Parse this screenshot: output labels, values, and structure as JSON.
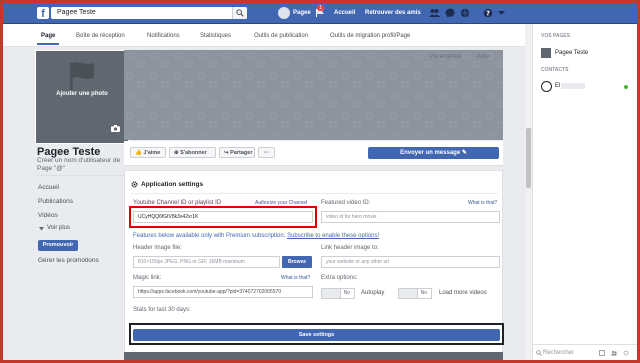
{
  "topbar": {
    "logo": "f",
    "search_value": "Pagee Teste",
    "profile_name": "Pagee",
    "home_label": "Accueil",
    "find_friends_label": "Retrouver des amis",
    "notification_count": "1"
  },
  "tabs": [
    {
      "label": "Page"
    },
    {
      "label": "Boîte de réception"
    },
    {
      "label": "Notifications"
    },
    {
      "label": "Statistiques"
    },
    {
      "label": "Outils de publication"
    },
    {
      "label": "Outils de migration profil/Page"
    }
  ],
  "left": {
    "add_photo_label": "Ajouter une photo",
    "page_name": "Pagee Teste",
    "username_prompt": "Créer un nom d'utilisateur de Page \"@\"",
    "nav": [
      "Accueil",
      "Publications",
      "Vidéos"
    ],
    "see_more": "Voir plus",
    "promote_label": "Promouvoir",
    "manage_promotions": "Gérer les promotions"
  },
  "cover": {
    "tabs": [
      "Paramètres",
      "Aide"
    ]
  },
  "actions": {
    "like": "J'aime",
    "follow": "S'abonner",
    "share": "Partager",
    "more": "···",
    "send_message": "Envoyer un message"
  },
  "settings": {
    "title": "Application settings",
    "channel_label": "Youtube Channel ID or playlist ID",
    "authorize_link": "Authorize your Channel",
    "channel_value": "UCyHQQ6fGtV8k3s42xr1K",
    "featured_label": "Featured video ID:",
    "featured_help": "What is that?",
    "featured_placeholder": "video id for hero movie",
    "premium_notice": "Features below available only with Premium subscription.",
    "subscribe_link": "Subscribe to enable these options!",
    "header_image_label": "Header image file:",
    "header_image_placeholder": "810×150px JPEG, PNG or GIF, 16MB maximum",
    "browse_label": "Browse",
    "link_header_label": "Link header image to:",
    "link_header_placeholder": "your website or any other url",
    "magic_link_label": "Magic link:",
    "magic_help": "What is that?",
    "magic_link_value": "https://apps.facebook.com/youtube-app/?pid=374072702065570",
    "extra_options_label": "Extra options:",
    "autoplay_toggle": "No",
    "autoplay_label": "Autoplay",
    "load_more_toggle": "No",
    "load_more_label": "Load more videos",
    "stats_label": "Stats for last 30 days:",
    "save_label": "Save settings"
  },
  "right": {
    "pages_heading": "VOS PAGES",
    "page_entry": "Pagee Teste",
    "contacts_heading": "CONTACTS",
    "contact_initial": "El",
    "chat_search_placeholder": "Rechercher"
  },
  "colors": {
    "brand": "#4267b2",
    "highlight_red": "#e00000",
    "frame_red": "#c0392b"
  }
}
